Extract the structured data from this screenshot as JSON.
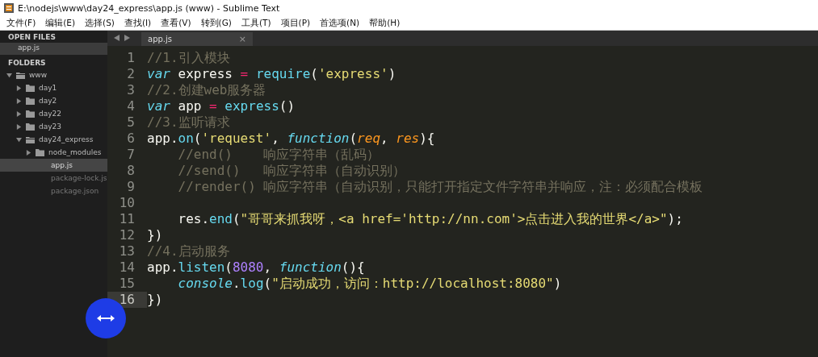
{
  "window": {
    "title": "E:\\nodejs\\www\\day24_express\\app.js (www) - Sublime Text"
  },
  "menu": [
    "文件(F)",
    "编辑(E)",
    "选择(S)",
    "查找(I)",
    "查看(V)",
    "转到(G)",
    "工具(T)",
    "项目(P)",
    "首选项(N)",
    "帮助(H)"
  ],
  "sidebar": {
    "open_files_heading": "OPEN FILES",
    "open_files": [
      {
        "label": "app.js",
        "selected": true
      }
    ],
    "folders_heading": "FOLDERS",
    "folders": [
      {
        "kind": "folder",
        "label": "www",
        "expanded": true,
        "children": [
          {
            "kind": "folder",
            "label": "day1",
            "expanded": false
          },
          {
            "kind": "folder",
            "label": "day2",
            "expanded": false
          },
          {
            "kind": "folder",
            "label": "day22",
            "expanded": false
          },
          {
            "kind": "folder",
            "label": "day23",
            "expanded": false
          },
          {
            "kind": "folder",
            "label": "day24_express",
            "expanded": true,
            "children": [
              {
                "kind": "folder",
                "label": "node_modules",
                "expanded": false
              },
              {
                "kind": "file",
                "label": "app.js",
                "selected": true
              },
              {
                "kind": "file",
                "label": "package-lock.js",
                "selected": false
              },
              {
                "kind": "file",
                "label": "package.json",
                "selected": false
              }
            ]
          }
        ]
      }
    ]
  },
  "tabs": [
    {
      "label": "app.js",
      "selected": true,
      "close": "×"
    }
  ],
  "editor": {
    "lines": [
      {
        "number": "1",
        "current": false,
        "tokens": [
          {
            "kind": "comment",
            "text": "//1.引入模块"
          }
        ]
      },
      {
        "number": "2",
        "current": false,
        "tokens": [
          {
            "kind": "keyword",
            "text": "var"
          },
          {
            "kind": "plain",
            "text": " express "
          },
          {
            "kind": "operator",
            "text": "= "
          },
          {
            "kind": "func",
            "text": "require"
          },
          {
            "kind": "plain",
            "text": "("
          },
          {
            "kind": "string",
            "text": "'express'"
          },
          {
            "kind": "plain",
            "text": ")"
          }
        ]
      },
      {
        "number": "3",
        "current": false,
        "tokens": [
          {
            "kind": "comment",
            "text": "//2.创建web服务器"
          }
        ]
      },
      {
        "number": "4",
        "current": false,
        "tokens": [
          {
            "kind": "keyword",
            "text": "var"
          },
          {
            "kind": "plain",
            "text": " app "
          },
          {
            "kind": "operator",
            "text": "= "
          },
          {
            "kind": "func",
            "text": "express"
          },
          {
            "kind": "plain",
            "text": "()"
          }
        ]
      },
      {
        "number": "5",
        "current": false,
        "tokens": [
          {
            "kind": "comment",
            "text": "//3.监听请求"
          }
        ]
      },
      {
        "number": "6",
        "current": false,
        "tokens": [
          {
            "kind": "plain",
            "text": "app."
          },
          {
            "kind": "func",
            "text": "on"
          },
          {
            "kind": "plain",
            "text": "("
          },
          {
            "kind": "string",
            "text": "'request'"
          },
          {
            "kind": "plain",
            "text": ", "
          },
          {
            "kind": "keyword",
            "text": "function"
          },
          {
            "kind": "plain",
            "text": "("
          },
          {
            "kind": "param",
            "text": "req"
          },
          {
            "kind": "plain",
            "text": ", "
          },
          {
            "kind": "param",
            "text": "res"
          },
          {
            "kind": "plain",
            "text": "){"
          }
        ]
      },
      {
        "number": "7",
        "current": false,
        "tokens": [
          {
            "kind": "comment",
            "text": "    //end()    响应字符串（乱码）"
          }
        ]
      },
      {
        "number": "8",
        "current": false,
        "tokens": [
          {
            "kind": "comment",
            "text": "    //send()   响应字符串（自动识别）"
          }
        ]
      },
      {
        "number": "9",
        "current": false,
        "tokens": [
          {
            "kind": "comment",
            "text": "    //render() 响应字符串（自动识别，只能打开指定文件字符串并响应，注：必须配合模板"
          }
        ]
      },
      {
        "number": "10",
        "current": false
      },
      {
        "number": "11",
        "current": false,
        "tokens": [
          {
            "kind": "plain",
            "text": "    res."
          },
          {
            "kind": "func",
            "text": "end"
          },
          {
            "kind": "plain",
            "text": "("
          },
          {
            "kind": "string",
            "text": "\"哥哥来抓我呀，<a href='http://nn.com'>点击进入我的世界</a>\""
          },
          {
            "kind": "plain",
            "text": ");"
          }
        ]
      },
      {
        "number": "12",
        "current": false,
        "tokens": [
          {
            "kind": "plain",
            "text": "})"
          }
        ]
      },
      {
        "number": "13",
        "current": false,
        "tokens": [
          {
            "kind": "comment",
            "text": "//4.启动服务"
          }
        ]
      },
      {
        "number": "14",
        "current": false,
        "tokens": [
          {
            "kind": "plain",
            "text": "app."
          },
          {
            "kind": "func",
            "text": "listen"
          },
          {
            "kind": "plain",
            "text": "("
          },
          {
            "kind": "number",
            "text": "8080"
          },
          {
            "kind": "plain",
            "text": ", "
          },
          {
            "kind": "keyword",
            "text": "function"
          },
          {
            "kind": "plain",
            "text": "(){"
          }
        ]
      },
      {
        "number": "15",
        "current": false,
        "tokens": [
          {
            "kind": "keyword",
            "text": "    console"
          },
          {
            "kind": "plain",
            "text": "."
          },
          {
            "kind": "func",
            "text": "log"
          },
          {
            "kind": "plain",
            "text": "("
          },
          {
            "kind": "string",
            "text": "\"启动成功，访问：http://localhost:8080\""
          },
          {
            "kind": "plain",
            "text": ")"
          }
        ]
      },
      {
        "number": "16",
        "current": true,
        "tokens": [
          {
            "kind": "plain",
            "text": "})"
          }
        ]
      }
    ]
  }
}
